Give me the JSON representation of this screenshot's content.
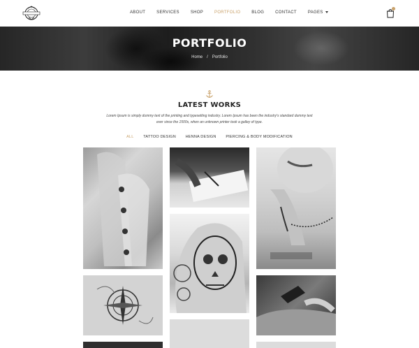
{
  "header": {
    "logo_icon": "tattoo-studio-logo",
    "nav": [
      {
        "label": "About",
        "active": false
      },
      {
        "label": "Services",
        "active": false
      },
      {
        "label": "Shop",
        "active": false
      },
      {
        "label": "Portfolio",
        "active": true
      },
      {
        "label": "Blog",
        "active": false
      },
      {
        "label": "Contact",
        "active": false
      },
      {
        "label": "Pages",
        "active": false,
        "dropdown": true
      }
    ],
    "cart_icon": "shopping-bag-icon"
  },
  "banner": {
    "title": "PORTFOLIO",
    "breadcrumb": {
      "home": "Home",
      "separator": "/",
      "current": "Portfolio"
    }
  },
  "section": {
    "icon": "anchor-icon",
    "title": "LATEST WORKS",
    "description": "Lorem Ipsum is simply dummy text of the printing and typesetting industry. Lorem Ipsum has been the industry's standard dummy text ever since the 1500s, when an unknown printer took a galley of type."
  },
  "filters": [
    {
      "label": "All",
      "active": true
    },
    {
      "label": "Tattoo Design",
      "active": false
    },
    {
      "label": "Henna Design",
      "active": false
    },
    {
      "label": "Piercing & Body Modification",
      "active": false
    }
  ],
  "colors": {
    "accent": "#c9a26b",
    "text": "#222222"
  }
}
